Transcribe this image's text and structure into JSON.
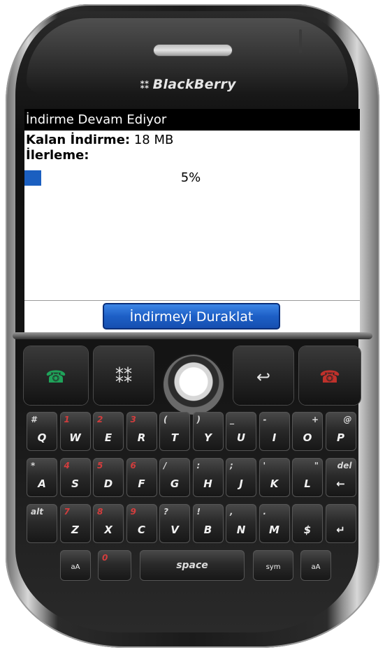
{
  "device": {
    "brand": "BlackBerry"
  },
  "screen": {
    "title": "İndirme Devam Ediyor",
    "remaining_label": "Kalan İndirme:",
    "remaining_value": "18 MB",
    "progress_label": "İlerleme:",
    "progress_percent_text": "5%",
    "progress_fraction": 0.05,
    "pause_button_label": "İndirmeyi Duraklat",
    "accent_color": "#1b5fc0"
  },
  "keyboard": {
    "row1": [
      {
        "main": "Q",
        "alt": "#",
        "alt_red": false
      },
      {
        "main": "W",
        "alt": "1",
        "alt_red": true
      },
      {
        "main": "E",
        "alt": "2",
        "alt_red": true
      },
      {
        "main": "R",
        "alt": "3",
        "alt_red": true
      },
      {
        "main": "T",
        "alt": "(",
        "alt_red": false
      },
      {
        "main": "Y",
        "alt": ")",
        "alt_red": false
      },
      {
        "main": "U",
        "alt": "_",
        "alt_red": false
      },
      {
        "main": "I",
        "alt": "-",
        "alt_red": false
      },
      {
        "main": "O",
        "alt": "+",
        "alt_red": false
      },
      {
        "main": "P",
        "alt": "@",
        "alt_red": false
      }
    ],
    "row2": [
      {
        "main": "A",
        "alt": "*",
        "alt_red": false
      },
      {
        "main": "S",
        "alt": "4",
        "alt_red": true
      },
      {
        "main": "D",
        "alt": "5",
        "alt_red": true
      },
      {
        "main": "F",
        "alt": "6",
        "alt_red": true
      },
      {
        "main": "G",
        "alt": "/",
        "alt_red": false
      },
      {
        "main": "H",
        "alt": ":",
        "alt_red": false
      },
      {
        "main": "J",
        "alt": ";",
        "alt_red": false
      },
      {
        "main": "K",
        "alt": "'",
        "alt_red": false
      },
      {
        "main": "L",
        "alt": "\"",
        "alt_red": false
      },
      {
        "main": "←",
        "alt": "del",
        "alt_red": false
      }
    ],
    "row3": [
      {
        "main": "",
        "alt": "alt",
        "alt_red": false
      },
      {
        "main": "Z",
        "alt": "7",
        "alt_red": true
      },
      {
        "main": "X",
        "alt": "8",
        "alt_red": true
      },
      {
        "main": "C",
        "alt": "9",
        "alt_red": true
      },
      {
        "main": "V",
        "alt": "?",
        "alt_red": false
      },
      {
        "main": "B",
        "alt": "!",
        "alt_red": false
      },
      {
        "main": "N",
        "alt": ",",
        "alt_red": false
      },
      {
        "main": "M",
        "alt": ".",
        "alt_red": false
      },
      {
        "main": "$",
        "alt": "",
        "alt_red": false
      },
      {
        "main": "↵",
        "alt": "",
        "alt_red": false
      }
    ],
    "row4": {
      "left_shift": "aA",
      "zero": "0",
      "space": "space",
      "sym": "sym",
      "right_shift": "aA"
    }
  },
  "icons": {
    "call": "call-icon",
    "menu": "blackberry-menu-icon",
    "trackball": "trackball",
    "back": "back-icon",
    "end": "end-call-icon"
  }
}
